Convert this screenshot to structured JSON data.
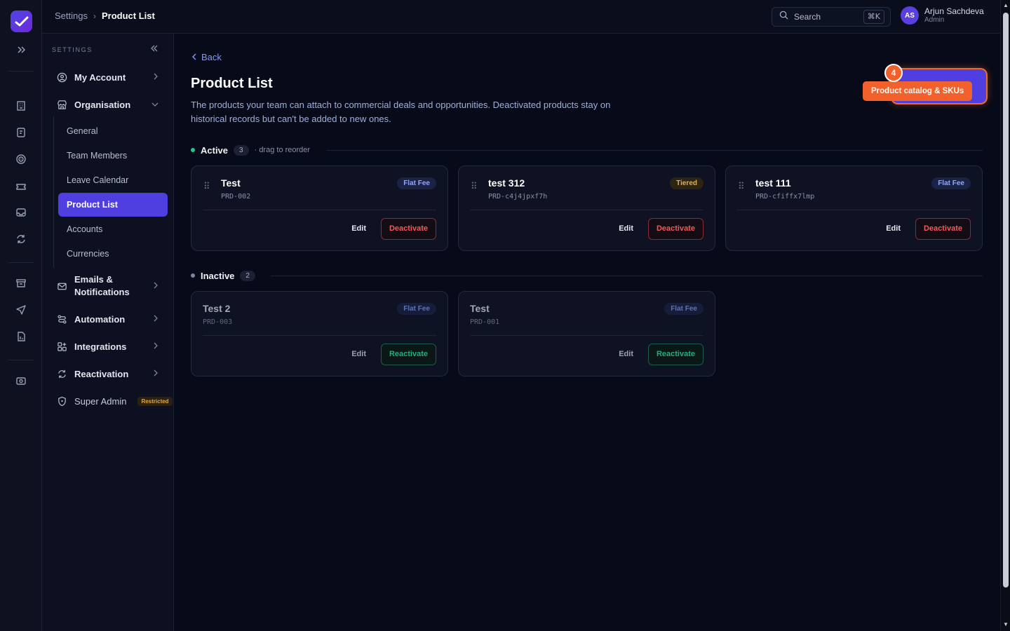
{
  "breadcrumb": {
    "parent": "Settings",
    "current": "Product List"
  },
  "search": {
    "placeholder": "Search",
    "shortcut": "⌘K"
  },
  "user": {
    "initials": "AS",
    "name": "Arjun Sachdeva",
    "role": "Admin"
  },
  "sidebar": {
    "heading": "SETTINGS",
    "items": [
      {
        "label": "My Account",
        "icon": "user-circle-icon"
      },
      {
        "label": "Organisation",
        "icon": "store-icon",
        "expanded": true
      },
      {
        "label": "Emails & Notifications",
        "icon": "mail-icon"
      },
      {
        "label": "Automation",
        "icon": "workflow-icon"
      },
      {
        "label": "Integrations",
        "icon": "grid-icon"
      },
      {
        "label": "Reactivation",
        "icon": "refresh-icon"
      },
      {
        "label": "Super Admin",
        "icon": "shield-icon",
        "badge": "Restricted"
      }
    ],
    "org_sub": [
      "General",
      "Team Members",
      "Leave Calendar",
      "Product List",
      "Accounts",
      "Currencies"
    ],
    "active_sub": "Product List"
  },
  "page": {
    "back": "Back",
    "title": "Product List",
    "description": "The products your team can attach to commercial deals and opportunities. Deactivated products stay on historical records but can't be added to new ones."
  },
  "active_section": {
    "title": "Active",
    "count": "3",
    "hint": "· drag to reorder"
  },
  "inactive_section": {
    "title": "Inactive",
    "count": "2"
  },
  "active_products": [
    {
      "name": "Test",
      "code": "PRD-002",
      "tag": "Flat Fee",
      "edit": "Edit",
      "action": "Deactivate"
    },
    {
      "name": "test 312",
      "code": "PRD-c4j4jpxf7h",
      "tag": "Tiered",
      "edit": "Edit",
      "action": "Deactivate"
    },
    {
      "name": "test 111",
      "code": "PRD-cfiffx7lmp",
      "tag": "Flat Fee",
      "edit": "Edit",
      "action": "Deactivate"
    }
  ],
  "inactive_products": [
    {
      "name": "Test 2",
      "code": "PRD-003",
      "tag": "Flat Fee",
      "edit": "Edit",
      "action": "Reactivate"
    },
    {
      "name": "Test",
      "code": "PRD-001",
      "tag": "Flat Fee",
      "edit": "Edit",
      "action": "Reactivate"
    }
  ],
  "tour": {
    "step": "4",
    "label": "Product catalog & SKUs"
  },
  "colors": {
    "accent": "#4f3ee0",
    "tour": "#f2612b",
    "danger": "#f05a5a",
    "success": "#22b07d"
  }
}
